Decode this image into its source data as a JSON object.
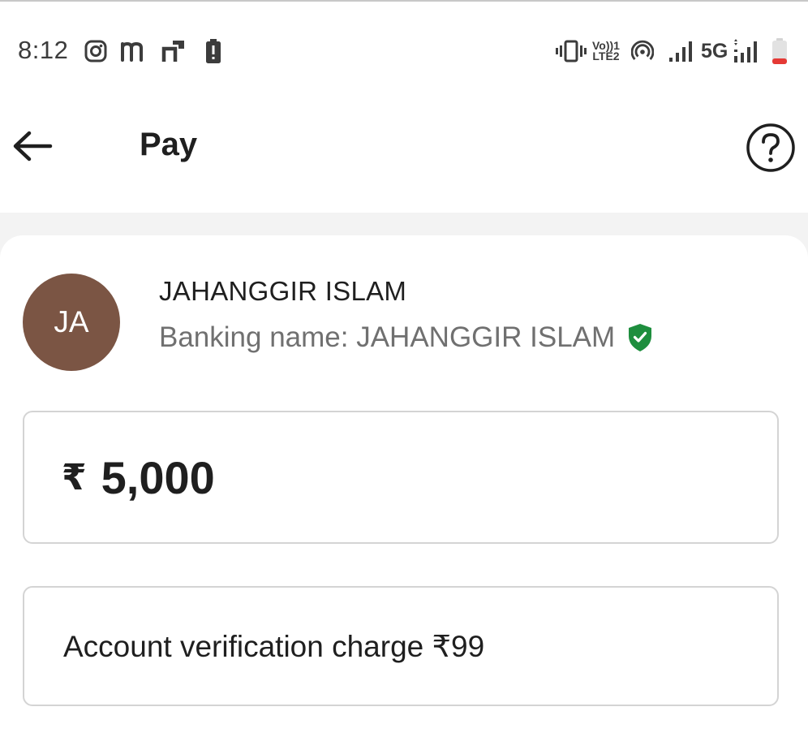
{
  "status_bar": {
    "time": "8:12",
    "left_icons": [
      "instagram-icon",
      "m-app-icon",
      "n-app-icon",
      "battery-alert-icon"
    ],
    "right_icons": [
      "vibrate-icon",
      "volte-icon",
      "hotspot-icon",
      "signal-icon",
      "network-icon",
      "signal-icon",
      "battery-low-icon"
    ],
    "volte_label_top": "Vo))1",
    "volte_label_bottom": "LTE2",
    "network_label": "5G"
  },
  "header": {
    "back_icon": "arrow-left-icon",
    "title": "Pay",
    "help_icon": "help-circle-icon"
  },
  "payee": {
    "initials": "JA",
    "avatar_color": "#7b5544",
    "name": "JAHANGGIR ISLAM",
    "banking_name": "Banking name: JAHANGGIR ISLAM",
    "verified_icon": "verified-shield-icon",
    "verified_color": "#1e8e3e"
  },
  "amount": {
    "currency": "₹",
    "value": "5,000"
  },
  "note": {
    "text": "Account verification charge ₹99"
  }
}
